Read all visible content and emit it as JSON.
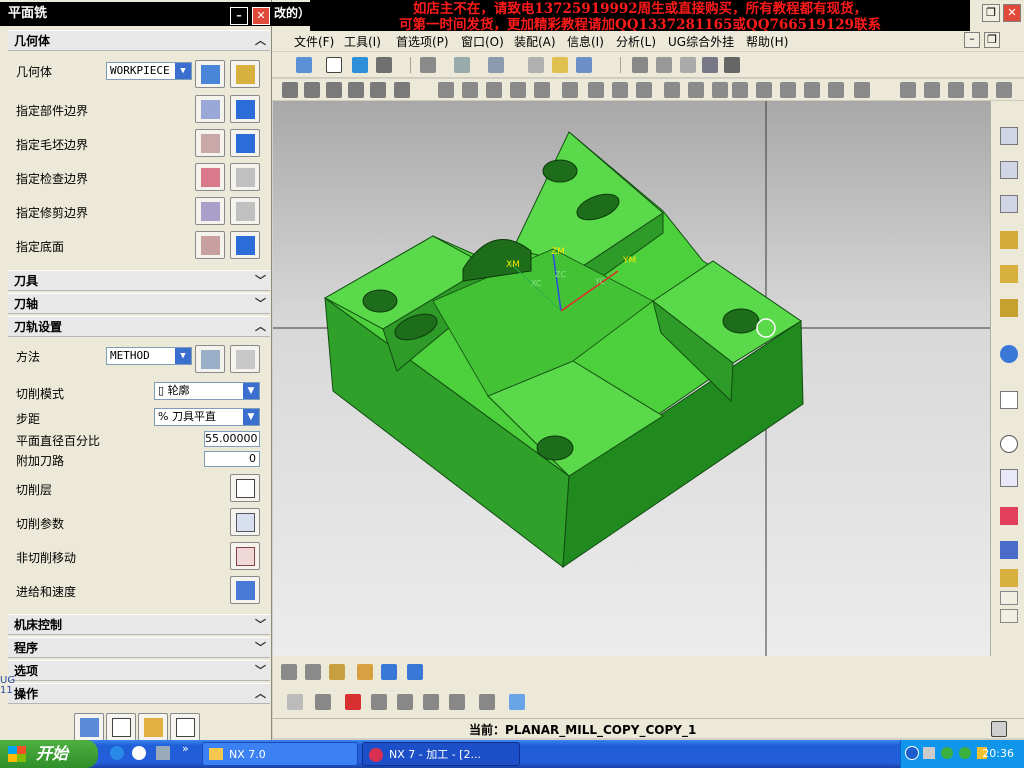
{
  "banner": {
    "line1": "如店主不在，请致电13725919992周生或直接购买，所有教程都有现货，",
    "line2": "可第一时间发货，更加精彩教程请加QQ1337281165或QQ766519129联系"
  },
  "title_tail": "改的）",
  "menu": [
    "文件(F)",
    "工具(I)",
    "首选项(P)",
    "窗口(O)",
    "装配(A)",
    "信息(I)",
    "分析(L)",
    "UG综合外挂",
    "帮助(H)"
  ],
  "panel": {
    "title": "平面铣",
    "sections": {
      "geometry": "几何体",
      "tool": "刀具",
      "axis": "刀轴",
      "path": "刀轨设置",
      "machine": "机床控制",
      "program": "程序",
      "options": "选项",
      "ops": "操作"
    },
    "geometry_label": "几何体",
    "geometry_value": "WORKPIECE",
    "rows": [
      "指定部件边界",
      "指定毛坯边界",
      "指定检查边界",
      "指定修剪边界",
      "指定底面"
    ],
    "method_label": "方法",
    "method_value": "METHOD",
    "cut_mode_label": "切削模式",
    "cut_mode_value": "轮廓",
    "step_label": "步距",
    "step_value": "% 刀具平直",
    "pct_label": "平面直径百分比",
    "pct_value": "55.00000",
    "extra_label": "附加刀路",
    "extra_value": "0",
    "cut_level": "切削层",
    "cut_params": "切削参数",
    "non_cut": "非切削移动",
    "feeds": "进给和速度",
    "side_text": "UG\n11"
  },
  "viewport": {
    "axis_zm": "ZM",
    "axis_ym": "YM",
    "axis_xm": "XM",
    "axis_zc": "ZC",
    "axis_yc": "YC",
    "axis_xc": "XC"
  },
  "status": "当前：PLANAR_MILL_COPY_COPY_1",
  "taskbar": {
    "start": "开始",
    "task1": "NX 7.0",
    "task2": "NX 7 - 加工 - [2...",
    "clock": "20:36"
  },
  "colors": {
    "part_top": "#4cd13c",
    "part_side_left": "#2fa02a",
    "part_side_right": "#208a1e",
    "banner_text": "#ff1a1a"
  }
}
